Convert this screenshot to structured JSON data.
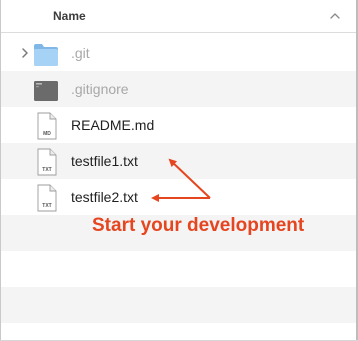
{
  "header": {
    "name_label": "Name"
  },
  "files": [
    {
      "name": ".git",
      "icon": "folder-icon",
      "dimmed": true,
      "expandable": true
    },
    {
      "name": ".gitignore",
      "icon": "generic-file-icon",
      "dimmed": true,
      "expandable": false
    },
    {
      "name": "README.md",
      "icon": "markdown-file-icon",
      "badge": "MD",
      "dimmed": false,
      "expandable": false
    },
    {
      "name": "testfile1.txt",
      "icon": "text-file-icon",
      "badge": "TXT",
      "dimmed": false,
      "expandable": false
    },
    {
      "name": "testfile2.txt",
      "icon": "text-file-icon",
      "badge": "TXT",
      "dimmed": false,
      "expandable": false
    }
  ],
  "annotation": {
    "text": "Start your development",
    "color": "#e5461f"
  },
  "colors": {
    "stripe": "#f4f4f5",
    "folder": "#8fc4ee",
    "dim_text": "#a8a8a8"
  }
}
